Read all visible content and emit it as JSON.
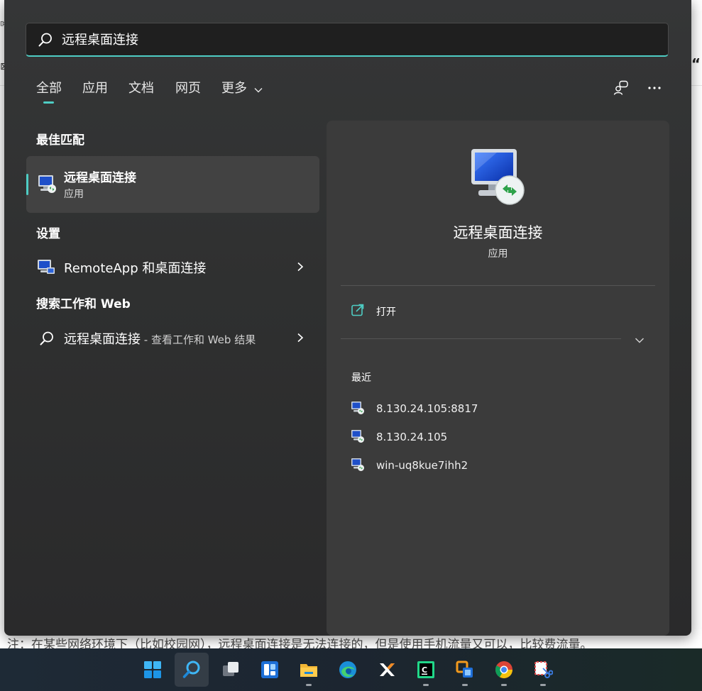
{
  "background": {
    "footnote": "注：在某些网络环境下（比如校园网），远程桌面连接是无法连接的，但是使用手机流量又可以，比较费流量。",
    "edge_left": "⊠",
    "edge_left_small": "몌",
    "edge_right": "“"
  },
  "search": {
    "query": "远程桌面连接"
  },
  "tabs": [
    {
      "label": "全部",
      "active": true
    },
    {
      "label": "应用"
    },
    {
      "label": "文档"
    },
    {
      "label": "网页"
    },
    {
      "label": "更多"
    }
  ],
  "top_icons": [
    "account-switch-icon",
    "more-options-icon"
  ],
  "best_match": {
    "title": "最佳匹配",
    "name": "远程桌面连接",
    "type": "应用"
  },
  "settings": {
    "title": "设置",
    "item_label": "RemoteApp 和桌面连接"
  },
  "web_search": {
    "title": "搜索工作和 Web",
    "query": "远程桌面连接",
    "suffix": " - 查看工作和 Web 结果"
  },
  "detail": {
    "name": "远程桌面连接",
    "type": "应用",
    "open_label": "打开",
    "recent_title": "最近",
    "recent": [
      "8.130.24.105:8817",
      "8.130.24.105",
      "win-uq8kue7ihh2"
    ]
  },
  "colors": {
    "accent": "#4ecdc4",
    "panel": "#2f3030",
    "card": "#3b3b3b"
  },
  "taskbar": {
    "items": [
      "windows-start-icon",
      "search-icon",
      "task-view-icon",
      "widgets-icon",
      "file-explorer-icon",
      "edge-icon",
      "xshell-icon",
      "pycharm-icon",
      "virtualbox-icon",
      "chrome-icon",
      "snipping-tool-icon"
    ]
  }
}
